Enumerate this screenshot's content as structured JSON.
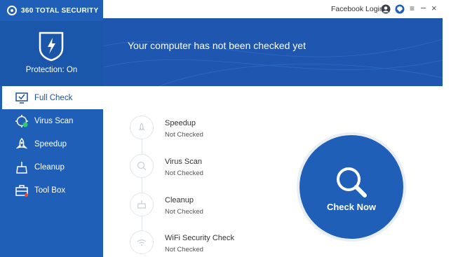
{
  "app": {
    "brand": "360 TOTAL SECURITY"
  },
  "titlebar": {
    "facebook_login": "Facebook Login",
    "icons": [
      "account-icon",
      "theme-icon",
      "menu-icon",
      "minimize-icon",
      "close-icon"
    ]
  },
  "protection": {
    "label": "Protection: On"
  },
  "banner": {
    "message": "Your computer has not been checked yet"
  },
  "sidebar": {
    "items": [
      {
        "label": "Full Check",
        "icon": "monitor-check-icon",
        "active": true
      },
      {
        "label": "Virus Scan",
        "icon": "virus-scan-icon",
        "active": false
      },
      {
        "label": "Speedup",
        "icon": "rocket-icon",
        "active": false
      },
      {
        "label": "Cleanup",
        "icon": "broom-icon",
        "active": false
      },
      {
        "label": "Tool Box",
        "icon": "toolbox-icon",
        "active": false
      }
    ]
  },
  "checks": [
    {
      "title": "Speedup",
      "status": "Not Checked",
      "icon": "rocket-icon"
    },
    {
      "title": "Virus Scan",
      "status": "Not Checked",
      "icon": "search-icon"
    },
    {
      "title": "Cleanup",
      "status": "Not Checked",
      "icon": "cleanup-icon"
    },
    {
      "title": "WiFi Security Check",
      "status": "Not Checked",
      "icon": "wifi-icon"
    }
  ],
  "check_now": {
    "label": "Check Now"
  },
  "colors": {
    "primary": "#1f5fb8",
    "banner": "#1f56b0",
    "active_text": "#1e4e94"
  }
}
